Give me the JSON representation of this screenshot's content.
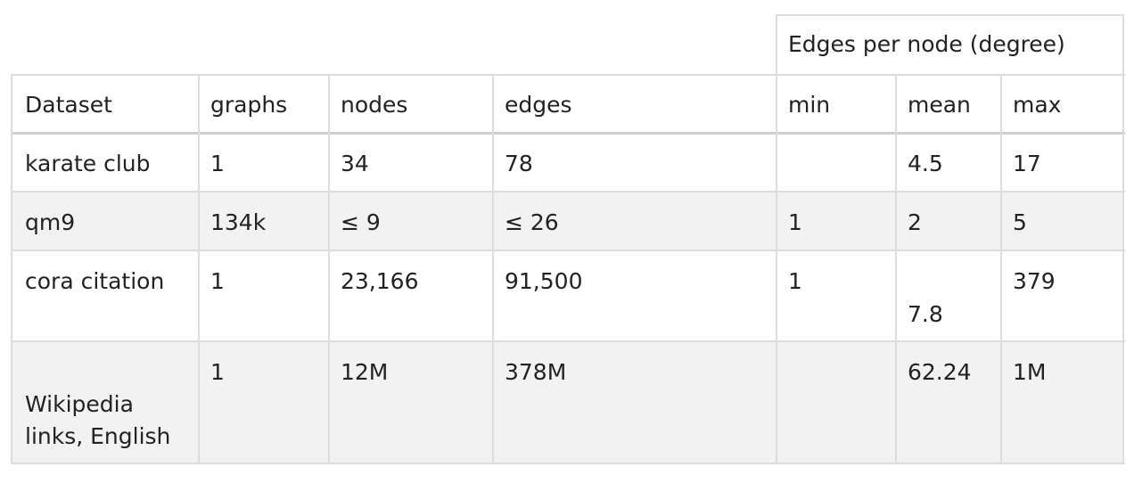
{
  "table": {
    "group_header": "Edges per node (degree)",
    "columns": [
      "Dataset",
      "graphs",
      "nodes",
      "edges",
      "min",
      "mean",
      "max"
    ],
    "rows": [
      {
        "dataset": "karate club",
        "graphs": "1",
        "nodes": "34",
        "edges": "78",
        "min": "",
        "mean": "4.5",
        "max": "17"
      },
      {
        "dataset": "qm9",
        "graphs": "134k",
        "nodes": "≤ 9",
        "edges": "≤ 26",
        "min": "1",
        "mean": "2",
        "max": "5"
      },
      {
        "dataset": "cora citation",
        "graphs": "1",
        "nodes": "23,166",
        "edges": "91,500",
        "min": "1",
        "mean": "7.8",
        "max": "379"
      },
      {
        "dataset": "Wikipedia links, English",
        "graphs": "1",
        "nodes": "12M",
        "edges": "378M",
        "min": "",
        "mean": "62.24",
        "max": "1M"
      }
    ]
  }
}
